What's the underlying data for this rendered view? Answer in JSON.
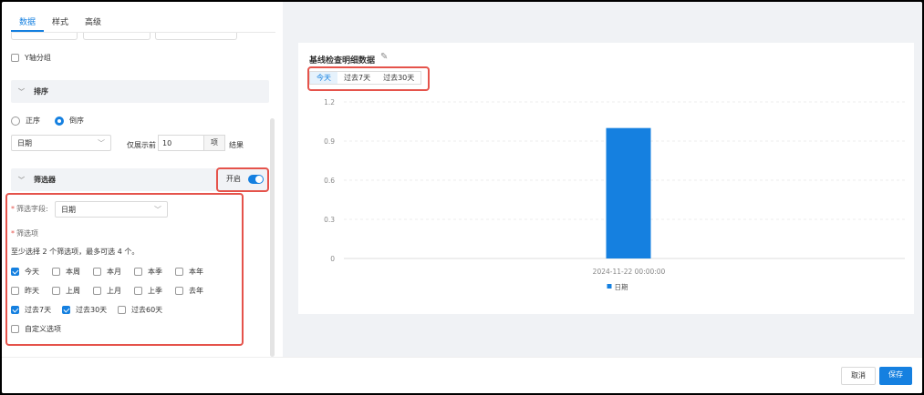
{
  "tabs": [
    "数据",
    "样式",
    "高级"
  ],
  "y_group": "Y轴分组",
  "sort": {
    "title": "排序",
    "asc": "正序",
    "desc": "倒序",
    "selected": "desc",
    "field": "日期",
    "show_prefix": "仅展示前",
    "count": "10",
    "unit": "项",
    "suffix": "结果"
  },
  "filter": {
    "title": "筛选器",
    "toggle_label": "开启",
    "enabled": true,
    "field_label": "筛选字段:",
    "field_value": "日期",
    "options_label": "筛选项",
    "hint": "至少选择 2 个筛选项，最多可选 4 个。",
    "options": [
      {
        "label": "今天",
        "checked": true
      },
      {
        "label": "本周",
        "checked": false
      },
      {
        "label": "本月",
        "checked": false
      },
      {
        "label": "本季",
        "checked": false
      },
      {
        "label": "本年",
        "checked": false
      },
      {
        "label": "昨天",
        "checked": false
      },
      {
        "label": "上周",
        "checked": false
      },
      {
        "label": "上月",
        "checked": false
      },
      {
        "label": "上季",
        "checked": false
      },
      {
        "label": "去年",
        "checked": false
      },
      {
        "label": "过去7天",
        "checked": true
      },
      {
        "label": "过去30天",
        "checked": true
      },
      {
        "label": "过去60天",
        "checked": false
      },
      {
        "label": "自定义选项",
        "checked": false
      }
    ]
  },
  "card": {
    "title": "基线检查明细数据",
    "segments": [
      "今天",
      "过去7天",
      "过去30天"
    ],
    "active_segment": 0
  },
  "chart_data": {
    "type": "bar",
    "categories": [
      "2024-11-22 00:00:00"
    ],
    "series": [
      {
        "name": "日期",
        "values": [
          1
        ],
        "color": "#1580e0"
      }
    ],
    "ylim": [
      0,
      1.2
    ],
    "yticks": [
      "0",
      "0.3",
      "0.6",
      "0.9",
      "1.2"
    ],
    "grid": true,
    "legend": "bottom"
  },
  "footer": {
    "cancel": "取消",
    "save": "保存"
  }
}
